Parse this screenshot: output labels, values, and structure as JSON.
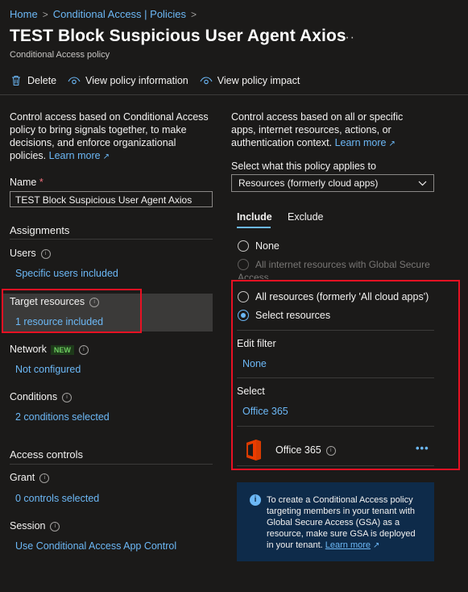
{
  "breadcrumb": {
    "home": "Home",
    "policies": "Conditional Access | Policies",
    "sep": ">"
  },
  "title": "TEST Block Suspicious User Agent Axios",
  "more": "···",
  "subtitle": "Conditional Access policy",
  "toolbar": {
    "delete": "Delete",
    "view_info": "View policy information",
    "view_impact": "View policy impact"
  },
  "left": {
    "desc": "Control access based on Conditional Access policy to bring signals together, to make decisions, and enforce organizational policies.",
    "learn_more": "Learn more",
    "name_label": "Name",
    "required_mark": "*",
    "name_value": "TEST Block Suspicious User Agent Axios",
    "assignments": "Assignments",
    "users_label": "Users",
    "users_value": "Specific users included",
    "target_label": "Target resources",
    "target_value": "1 resource included",
    "network_label": "Network",
    "network_badge": "NEW",
    "network_value": "Not configured",
    "conditions_label": "Conditions",
    "conditions_value": "2 conditions selected",
    "access_controls": "Access controls",
    "grant_label": "Grant",
    "grant_value": "0 controls selected",
    "session_label": "Session",
    "session_value": "Use Conditional Access App Control"
  },
  "right": {
    "desc": "Control access based on all or specific apps, internet resources, actions, or authentication context.",
    "learn_more": "Learn more",
    "applies_label": "Select what this policy applies to",
    "applies_value": "Resources (formerly cloud apps)",
    "tab_include": "Include",
    "tab_exclude": "Exclude",
    "opt_none": "None",
    "opt_internet": "All internet resources with Global Secure Access",
    "opt_all": "All resources (formerly 'All cloud apps')",
    "opt_select": "Select resources",
    "edit_filter_label": "Edit filter",
    "edit_filter_value": "None",
    "select_label": "Select",
    "select_value": "Office 365",
    "app_name": "Office 365",
    "app_more": "•••",
    "info_text": "To create a Conditional Access policy targeting members in your tenant with Global Secure Access (GSA) as a resource, make sure GSA is deployed in your tenant.",
    "info_learn_more": "Learn more"
  },
  "colors": {
    "accent": "#6cb8f6",
    "highlight_border": "#e81123",
    "office_logo": "#d83b01"
  }
}
